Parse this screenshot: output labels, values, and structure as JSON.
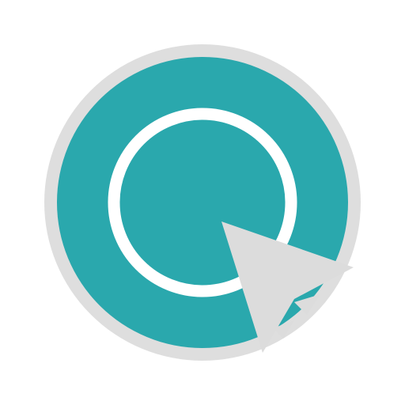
{
  "icon": {
    "name": "screen-recorder-cursor-icon",
    "colors": {
      "outer_ring": "#dedede",
      "disc": "#2aa8ad",
      "inner_ring": "#ffffff",
      "cursor": "#dcdcdc",
      "background": "#ffffff"
    }
  }
}
